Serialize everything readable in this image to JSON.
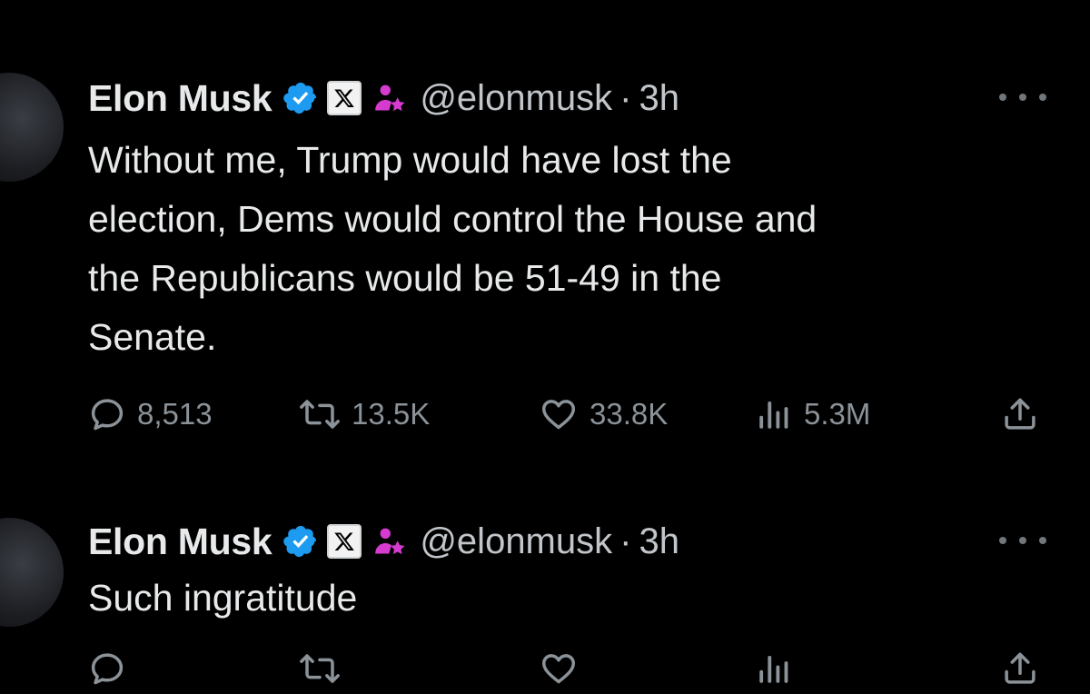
{
  "tweets": [
    {
      "author": {
        "name": "Elon Musk",
        "handle": "@elonmusk"
      },
      "separator": "·",
      "time": "3h",
      "text": "Without me, Trump would have lost the\nelection, Dems would control the House and\nthe Republicans would be 51-49 in the\nSenate.",
      "stats": {
        "replies": "8,513",
        "reposts": "13.5K",
        "likes": "33.8K",
        "views": "5.3M"
      }
    },
    {
      "author": {
        "name": "Elon Musk",
        "handle": "@elonmusk"
      },
      "separator": "·",
      "time": "3h",
      "text": "Such ingratitude"
    }
  ],
  "icons": {
    "verified": "verified-badge-icon",
    "affiliate": "x-affiliate-icon",
    "affiliate_org": "affiliate-person-icon",
    "more": "more-dots-icon",
    "reply": "reply-bubble-icon",
    "repost": "repost-arrows-icon",
    "like": "heart-icon",
    "views": "views-bars-icon",
    "share": "share-upload-icon"
  },
  "colors": {
    "background": "#000000",
    "text": "#e7e9ea",
    "secondary_text": "#c2c6ca",
    "action_gray": "#8b9298",
    "verified_blue": "#1d9bf0",
    "affiliate_magenta": "#d63bd0"
  }
}
